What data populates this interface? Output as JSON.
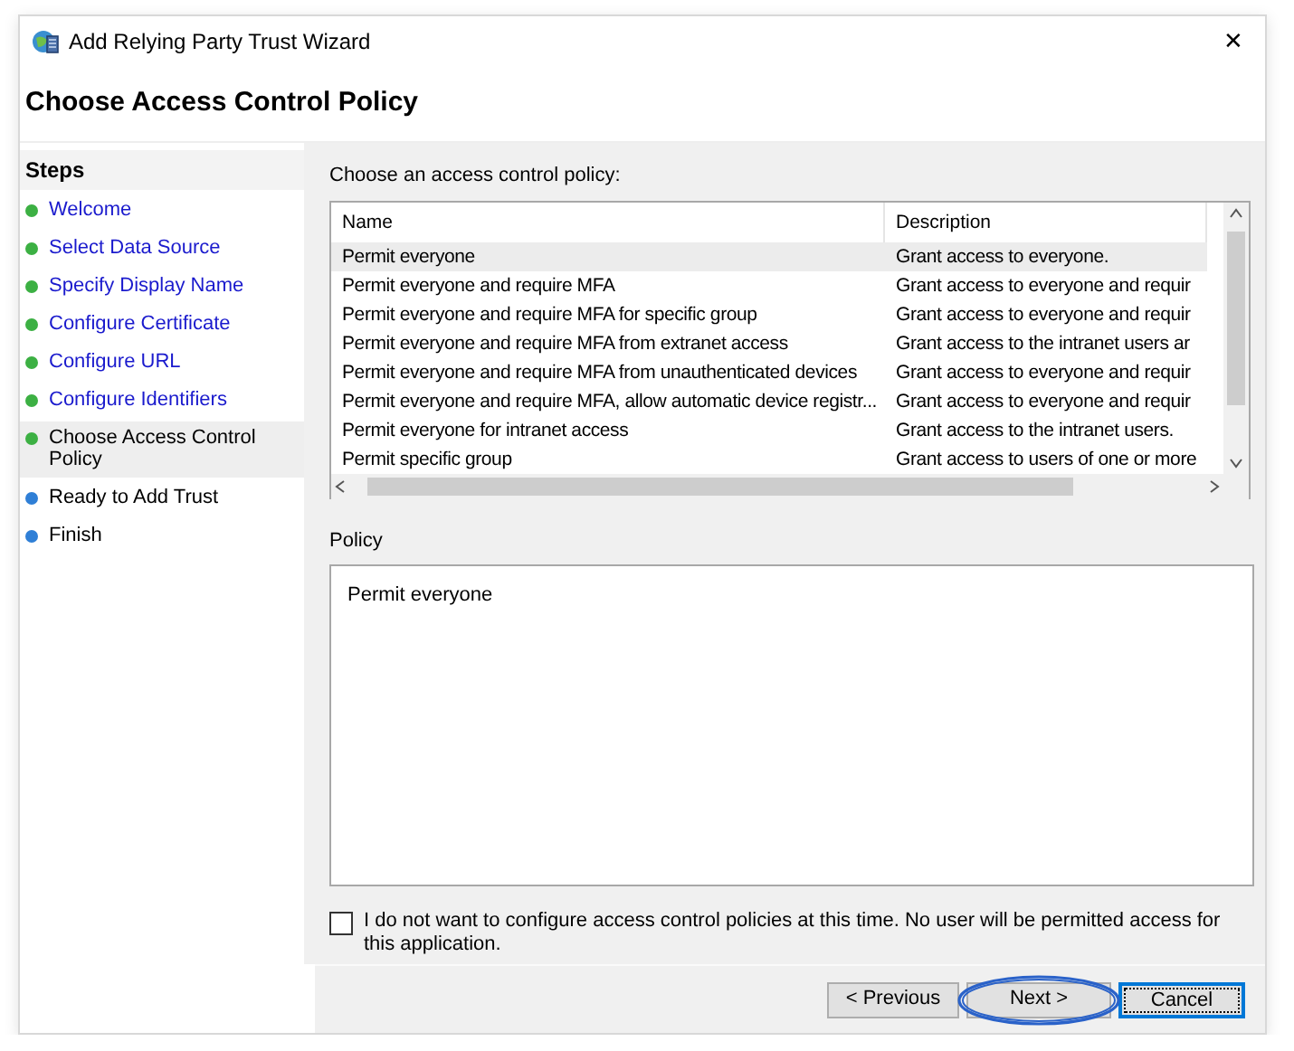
{
  "window": {
    "title": "Add Relying Party Trust Wizard",
    "close": "✕"
  },
  "page_title": "Choose Access Control Policy",
  "steps": {
    "heading": "Steps",
    "items": [
      {
        "label": "Welcome",
        "kind": "link",
        "color": "#3cb043",
        "selected": false
      },
      {
        "label": "Select Data Source",
        "kind": "link",
        "color": "#3cb043",
        "selected": false
      },
      {
        "label": "Specify Display Name",
        "kind": "link",
        "color": "#3cb043",
        "selected": false
      },
      {
        "label": "Configure Certificate",
        "kind": "link",
        "color": "#3cb043",
        "selected": false
      },
      {
        "label": "Configure URL",
        "kind": "link",
        "color": "#3cb043",
        "selected": false
      },
      {
        "label": "Configure Identifiers",
        "kind": "link",
        "color": "#3cb043",
        "selected": false
      },
      {
        "label": "Choose Access Control Policy",
        "kind": "text",
        "color": "#3cb043",
        "selected": true
      },
      {
        "label": "Ready to Add Trust",
        "kind": "text",
        "color": "#2f7fd6",
        "selected": false
      },
      {
        "label": "Finish",
        "kind": "text",
        "color": "#2f7fd6",
        "selected": false
      }
    ]
  },
  "policy_list": {
    "label": "Choose an access control policy:",
    "columns": [
      "Name",
      "Description"
    ],
    "rows": [
      {
        "name": "Permit everyone",
        "description": "Grant access to everyone.",
        "selected": true
      },
      {
        "name": "Permit everyone and require MFA",
        "description": "Grant access to everyone and requir",
        "selected": false
      },
      {
        "name": "Permit everyone and require MFA for specific group",
        "description": "Grant access to everyone and requir",
        "selected": false
      },
      {
        "name": "Permit everyone and require MFA from extranet access",
        "description": "Grant access to the intranet users ar",
        "selected": false
      },
      {
        "name": "Permit everyone and require MFA from unauthenticated devices",
        "description": "Grant access to everyone and requir",
        "selected": false
      },
      {
        "name": "Permit everyone and require MFA, allow automatic device registr...",
        "description": "Grant access to everyone and requir",
        "selected": false
      },
      {
        "name": "Permit everyone for intranet access",
        "description": "Grant access to the intranet users.",
        "selected": false
      },
      {
        "name": "Permit specific group",
        "description": "Grant access to users of one or more",
        "selected": false
      }
    ]
  },
  "policy": {
    "label": "Policy",
    "text": "Permit everyone"
  },
  "skip_checkbox": {
    "label": "I do not want to configure access control policies at this time. No user will be permitted access for this application.",
    "checked": false
  },
  "buttons": [
    {
      "label": "< Previous",
      "kind": "normal"
    },
    {
      "label": "Next >",
      "kind": "highlighted"
    },
    {
      "label": "Cancel",
      "kind": "default"
    }
  ]
}
